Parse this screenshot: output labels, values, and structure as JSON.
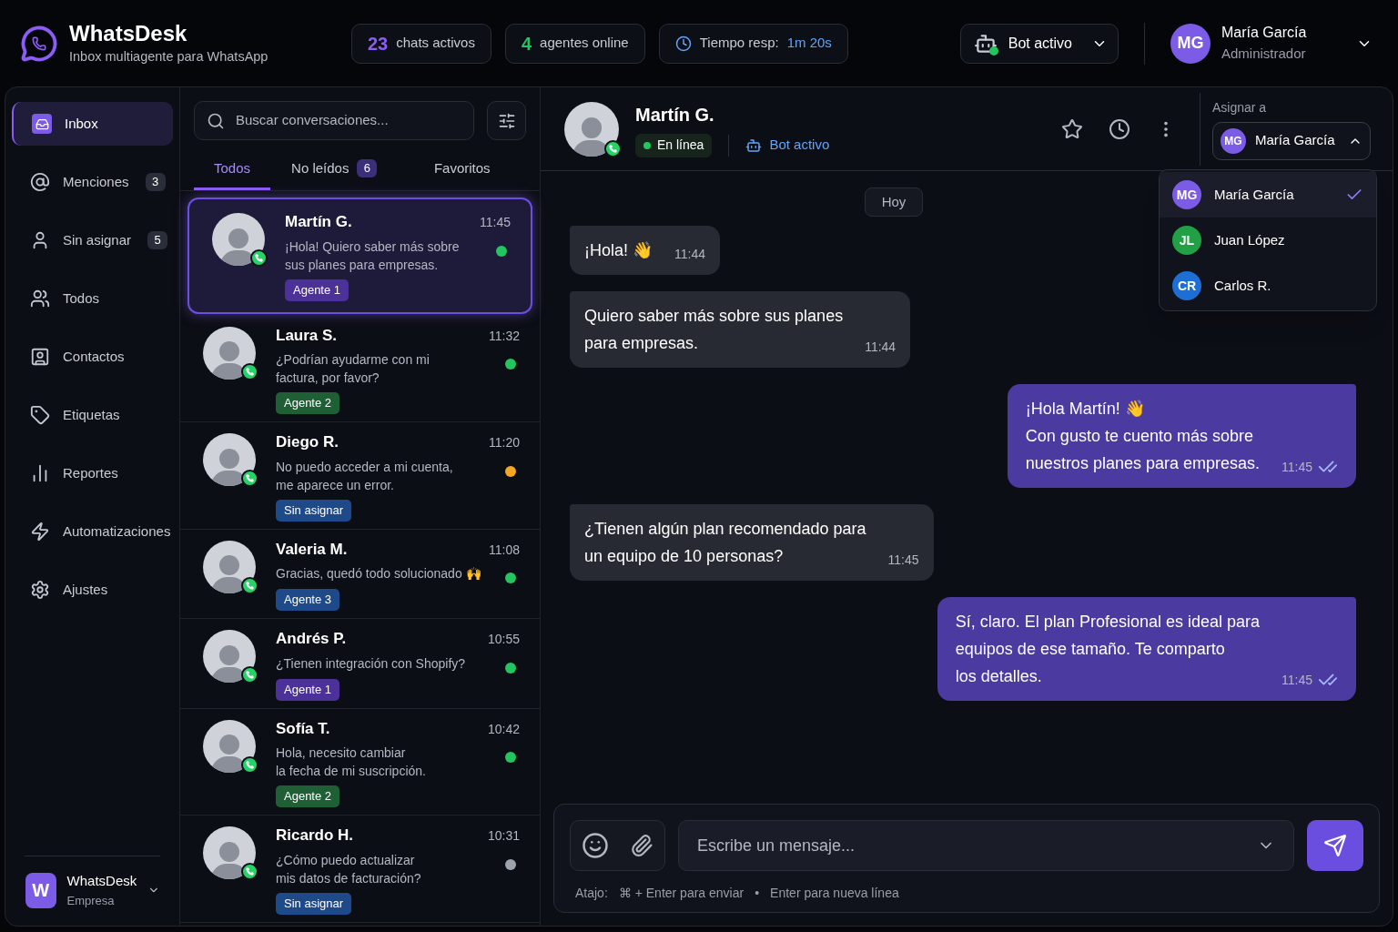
{
  "brand": {
    "name": "WhatsDesk",
    "tagline": "Inbox multiagente para WhatsApp"
  },
  "stats": [
    {
      "kind": "count",
      "value": "23",
      "label": "chats activos",
      "color": "#8b5cf6"
    },
    {
      "kind": "count",
      "value": "4",
      "label": "agentes online",
      "color": "#22c55e"
    },
    {
      "kind": "time",
      "label": "Tiempo resp:",
      "value": "1m 20s",
      "color": "#60a5fa"
    }
  ],
  "bot": {
    "label": "Bot activo",
    "active": true
  },
  "user": {
    "initials": "MG",
    "name": "María García",
    "role": "Administrador"
  },
  "sidebar": {
    "items": [
      {
        "label": "Inbox",
        "selected": true
      },
      {
        "label": "Menciones",
        "badge": "3",
        "selected": false
      },
      {
        "label": "Sin asignar",
        "badge": "5",
        "selected": false
      },
      {
        "label": "Todos",
        "selected": false
      },
      {
        "label": "Contactos",
        "selected": false
      },
      {
        "label": "Etiquetas",
        "selected": false
      },
      {
        "label": "Reportes",
        "selected": false
      },
      {
        "label": "Automatizaciones",
        "selected": false
      },
      {
        "label": "Ajustes",
        "selected": false
      }
    ],
    "workspace": {
      "initial": "W",
      "name": "WhatsDesk",
      "plan": "Empresa"
    }
  },
  "search": {
    "placeholder": "Buscar conversaciones..."
  },
  "tabs": [
    {
      "label": "Todos",
      "selected": true
    },
    {
      "label": "No leídos",
      "badge": "6",
      "selected": false
    },
    {
      "label": "Favoritos",
      "selected": false
    }
  ],
  "conversations": [
    {
      "name": "Martín G.",
      "time": "11:45",
      "preview": "¡Hola! Quiero saber más sobre\nsus planes para empresas.",
      "color": "#22c55e",
      "tag": {
        "label": "Agente 1",
        "color": "#4c3199"
      },
      "selected": true
    },
    {
      "name": "Laura S.",
      "time": "11:32",
      "preview": "¿Podrían ayudarme con mi\nfactura, por favor?",
      "color": "#22c55e",
      "tag": {
        "label": "Agente 2",
        "color": "#1f5f35"
      },
      "selected": false
    },
    {
      "name": "Diego R.",
      "time": "11:20",
      "preview": "No puedo acceder a mi cuenta,\nme aparece un error.",
      "color": "#f5a524",
      "tag": {
        "label": "Sin asignar",
        "color": "#1e4a8a"
      },
      "selected": false
    },
    {
      "name": "Valeria M.",
      "time": "11:08",
      "preview": "Gracias, quedó todo solucionado 🙌",
      "color": "#22c55e",
      "tag": {
        "label": "Agente 3",
        "color": "#1e4a8a"
      },
      "selected": false
    },
    {
      "name": "Andrés P.",
      "time": "10:55",
      "preview": "¿Tienen integración con Shopify?",
      "color": "#22c55e",
      "tag": {
        "label": "Agente 1",
        "color": "#4c3199"
      },
      "selected": false
    },
    {
      "name": "Sofía T.",
      "time": "10:42",
      "preview": "Hola, necesito cambiar\nla fecha de mi suscripción.",
      "color": "#22c55e",
      "tag": {
        "label": "Agente 2",
        "color": "#1f5f35"
      },
      "selected": false
    },
    {
      "name": "Ricardo H.",
      "time": "10:31",
      "preview": "¿Cómo puedo actualizar\nmis datos de facturación?",
      "color": "#9ca3af",
      "tag": {
        "label": "Sin asignar",
        "color": "#1e4a8a"
      },
      "selected": false
    }
  ],
  "chat": {
    "name": "Martín G.",
    "status": "En línea",
    "online": true,
    "bot": "Bot activo",
    "assign": {
      "label": "Asignar a",
      "initials": "MG",
      "value": "María García",
      "expanded": true,
      "options": [
        {
          "initials": "MG",
          "name": "María García",
          "color": "#7c5ce6",
          "selected": true
        },
        {
          "initials": "JL",
          "name": "Juan López",
          "color": "#22a046",
          "selected": false
        },
        {
          "initials": "CR",
          "name": "Carlos R.",
          "color": "#1d6fd6",
          "selected": false
        }
      ]
    },
    "date": "Hoy",
    "messages": [
      {
        "kind": "incoming",
        "text": "¡Hola! 👋",
        "time": "11:44"
      },
      {
        "kind": "incoming",
        "text": "Quiero saber más sobre sus planes\npara empresas.",
        "time": "11:44"
      },
      {
        "kind": "outgoing",
        "text": "¡Hola Martín! 👋\nCon gusto te cuento más sobre\nnuestros planes para empresas.",
        "time": "11:45",
        "read": true
      },
      {
        "kind": "incoming",
        "text": "¿Tienen algún plan recomendado para\nun equipo de 10 personas?",
        "time": "11:45"
      },
      {
        "kind": "outgoing",
        "text": "Sí, claro. El plan Profesional es ideal para\nequipos de ese tamaño. Te comparto\nlos detalles.",
        "time": "11:45",
        "read": true
      }
    ]
  },
  "composer": {
    "placeholder": "Escribe un mensaje...",
    "hint": {
      "label": "Atajo:",
      "separator": "•",
      "items": [
        "⌘ + Enter para enviar",
        "Enter para nueva línea"
      ]
    }
  }
}
